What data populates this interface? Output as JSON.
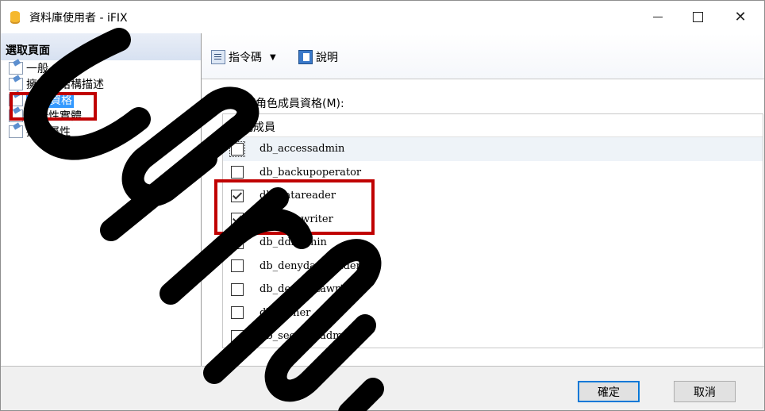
{
  "window": {
    "title": "資料庫使用者 - iFIX"
  },
  "left": {
    "header": "選取頁面",
    "items": [
      {
        "label": "一般"
      },
      {
        "label": "擁有的結構描述"
      },
      {
        "label": "成員資格"
      },
      {
        "label": "安全性實體"
      },
      {
        "label": "擴充屬性"
      }
    ]
  },
  "toolbar": {
    "script_label": "指令碼",
    "help_label": "說明"
  },
  "main": {
    "section_label": "資料庫角色成員資格(M):",
    "column_header": "角色成員",
    "roles": [
      {
        "name": "db_accessadmin",
        "checked": false
      },
      {
        "name": "db_backupoperator",
        "checked": false
      },
      {
        "name": "db_datareader",
        "checked": true
      },
      {
        "name": "db_datawriter",
        "checked": true
      },
      {
        "name": "db_ddladmin",
        "checked": false
      },
      {
        "name": "db_denydatareader",
        "checked": false
      },
      {
        "name": "db_denydatawriter",
        "checked": false
      },
      {
        "name": "db_owner",
        "checked": false
      },
      {
        "name": "db_securityadmin",
        "checked": false
      }
    ]
  },
  "footer": {
    "ok_label": "確定",
    "cancel_label": "取消"
  },
  "colors": {
    "highlight": "#c00000",
    "selection": "#3399ff",
    "watermark": "#000000"
  }
}
